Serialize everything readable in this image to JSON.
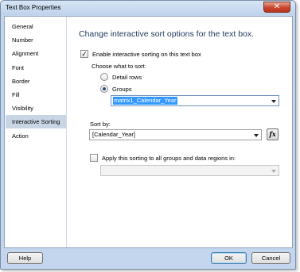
{
  "window": {
    "title": "Text Box Properties",
    "close_glyph": "✕"
  },
  "nav": {
    "items": [
      {
        "label": "General"
      },
      {
        "label": "Number"
      },
      {
        "label": "Alignment"
      },
      {
        "label": "Font"
      },
      {
        "label": "Border"
      },
      {
        "label": "Fill"
      },
      {
        "label": "Visibility"
      },
      {
        "label": "Interactive Sorting"
      },
      {
        "label": "Action"
      }
    ],
    "selected": "Interactive Sorting"
  },
  "content": {
    "heading": "Change interactive sort options for the text box.",
    "enable_checkbox": {
      "label": "Enable interactive sorting on this text box",
      "checked": true,
      "glyph": "✓"
    },
    "choose_label": "Choose what to sort:",
    "radio_detail": {
      "label": "Detail rows",
      "selected": false
    },
    "radio_groups": {
      "label": "Groups",
      "selected": true
    },
    "groups_combo": {
      "value": "matrix1_Calendar_Year"
    },
    "sort_by_label": "Sort by:",
    "sort_by_combo": {
      "value": "[Calendar_Year]"
    },
    "fx_label": "fx",
    "apply_checkbox": {
      "label": "Apply this sorting to all groups and data regions in:",
      "checked": false
    },
    "apply_combo": {
      "value": ""
    }
  },
  "footer": {
    "help_label": "Help",
    "ok_label": "OK",
    "cancel_label": "Cancel"
  },
  "colors": {
    "frame": "#c3d6ee",
    "nav_selected": "#c8d5e4",
    "heading": "#1e395b",
    "close": "#c9452c",
    "highlight": "#3399ff"
  }
}
